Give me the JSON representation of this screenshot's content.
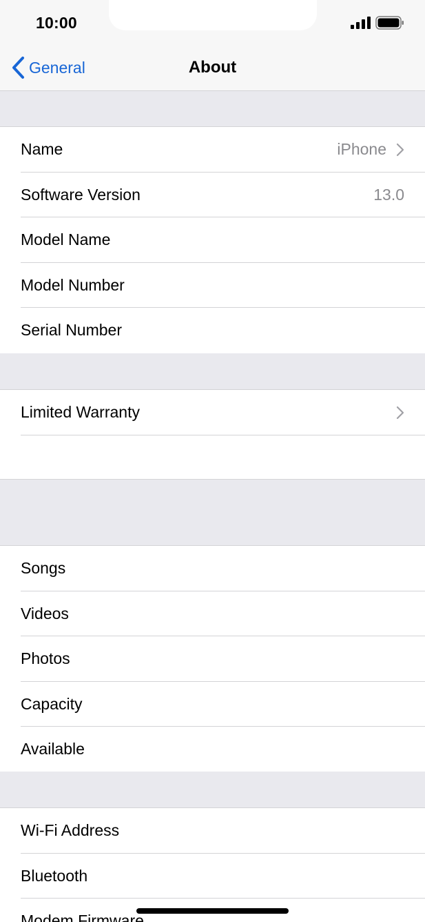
{
  "status_bar": {
    "time": "10:00"
  },
  "nav": {
    "back_label": "General",
    "title": "About"
  },
  "group1": [
    {
      "label": "Name",
      "value": "iPhone",
      "chevron": true
    },
    {
      "label": "Software Version",
      "value": "13.0",
      "chevron": false
    },
    {
      "label": "Model Name",
      "value": "",
      "chevron": false
    },
    {
      "label": "Model Number",
      "value": "",
      "chevron": false
    },
    {
      "label": "Serial Number",
      "value": "",
      "chevron": false
    }
  ],
  "group2": [
    {
      "label": "Limited Warranty",
      "value": "",
      "chevron": true
    },
    {
      "label": "",
      "value": "",
      "chevron": false
    }
  ],
  "group3": [
    {
      "label": "Songs"
    },
    {
      "label": "Videos"
    },
    {
      "label": "Photos"
    },
    {
      "label": "Capacity"
    },
    {
      "label": "Available"
    }
  ],
  "group4": [
    {
      "label": "Wi-Fi Address"
    },
    {
      "label": "Bluetooth"
    },
    {
      "label": "Modem Firmware"
    }
  ],
  "colors": {
    "accent": "#1866d6",
    "background_gray": "#e9e9ee",
    "secondary_text": "#8a8a8e"
  }
}
